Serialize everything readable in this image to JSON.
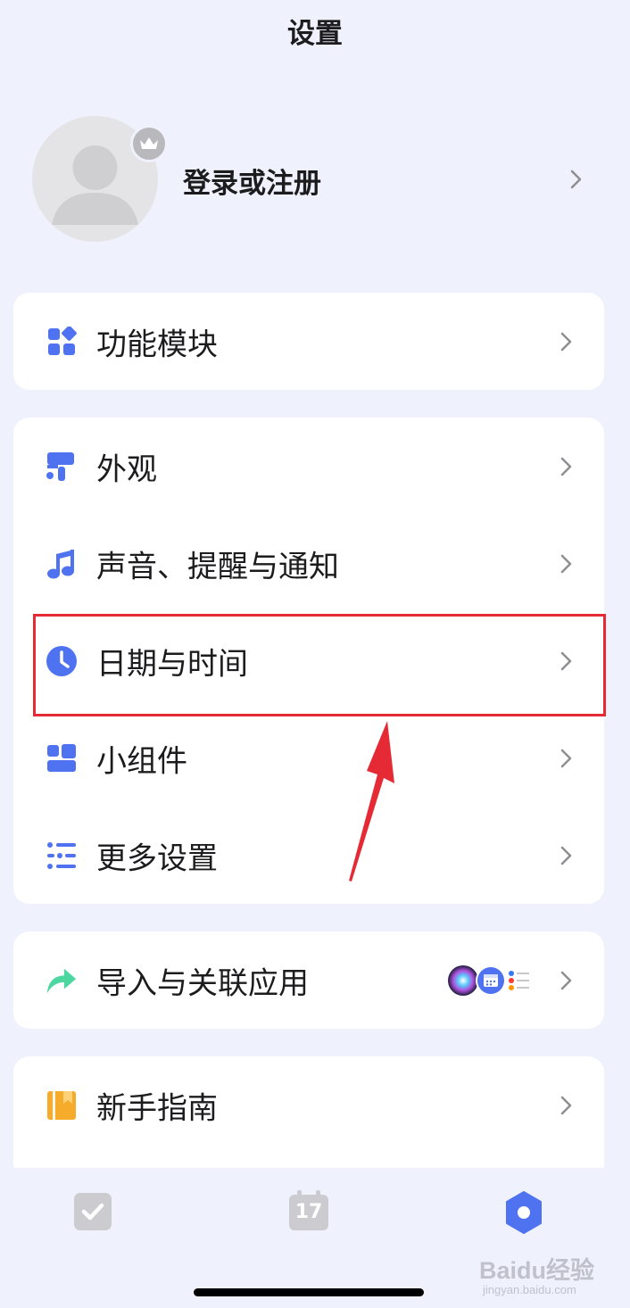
{
  "header": {
    "title": "设置"
  },
  "profile": {
    "label": "登录或注册"
  },
  "sections": {
    "modules": {
      "label": "功能模块"
    },
    "appearance": {
      "label": "外观"
    },
    "sound": {
      "label": "声音、提醒与通知"
    },
    "datetime": {
      "label": "日期与时间"
    },
    "widgets": {
      "label": "小组件"
    },
    "more": {
      "label": "更多设置"
    },
    "import": {
      "label": "导入与关联应用"
    },
    "guide": {
      "label": "新手指南"
    }
  },
  "tabbar": {
    "calendar_day": "17"
  },
  "watermark": {
    "text": "Baidu经验",
    "sub": "jingyan.baidu.com"
  },
  "colors": {
    "accent": "#4f73f0",
    "background": "#eff1fc",
    "highlight": "#e52a35",
    "import_icon": "#4cd6a0",
    "guide_icon": "#f6ab2a"
  },
  "icons": {
    "modules": "grid-icon",
    "appearance": "paint-roller-icon",
    "sound": "music-note-icon",
    "datetime": "clock-icon",
    "widgets": "widgets-icon",
    "more": "list-settings-icon",
    "import": "share-arrow-icon",
    "guide": "book-icon"
  }
}
